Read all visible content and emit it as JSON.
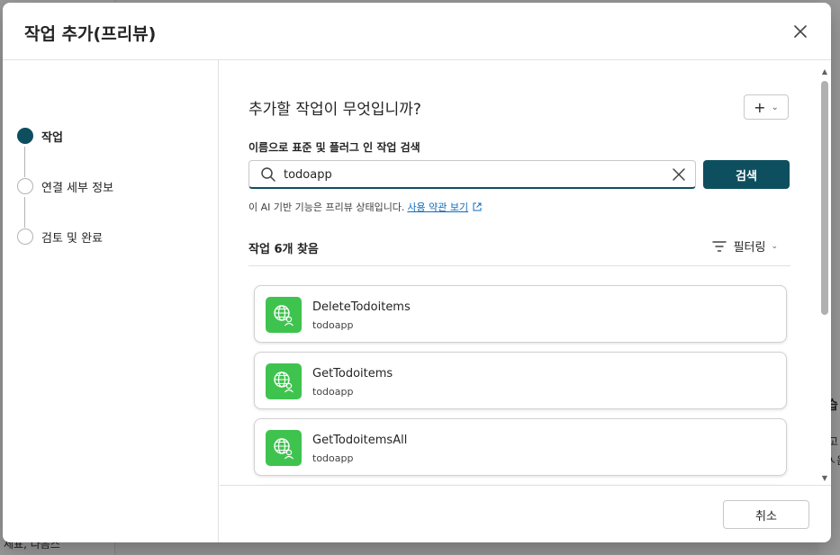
{
  "dialog": {
    "title": "작업 추가(프리뷰)",
    "close_icon": "close-icon"
  },
  "steps": [
    {
      "label": "작업",
      "active": true
    },
    {
      "label": "연결 세부 정보",
      "active": false
    },
    {
      "label": "검토 및 완료",
      "active": false
    }
  ],
  "main": {
    "heading": "추가할 작업이 무엇입니까?",
    "add_menu_symbol": "+",
    "search_label": "이름으로 표준 및 플러그 인 작업 검색",
    "search_value": "todoapp",
    "search_button": "검색",
    "ai_note": "이 AI 기반 기능은 프리뷰 상태입니다.",
    "ai_link": "사용 약관 보기",
    "results_count": "작업 6개 찾음",
    "filter_label": "필터링"
  },
  "actions": [
    {
      "name": "DeleteTodoitems",
      "connector": "todoapp"
    },
    {
      "name": "GetTodoitems",
      "connector": "todoapp"
    },
    {
      "name": "GetTodoitemsAll",
      "connector": "todoapp"
    }
  ],
  "footer": {
    "cancel": "취소"
  },
  "background": {
    "frag1": "세표, 다음스",
    "frag2": "습",
    "frag3": "고",
    "frag4": "ㅅ음"
  },
  "colors": {
    "primary": "#0e4f5f",
    "action_icon_bg": "#3fc34f",
    "link": "#0f6cbd"
  }
}
